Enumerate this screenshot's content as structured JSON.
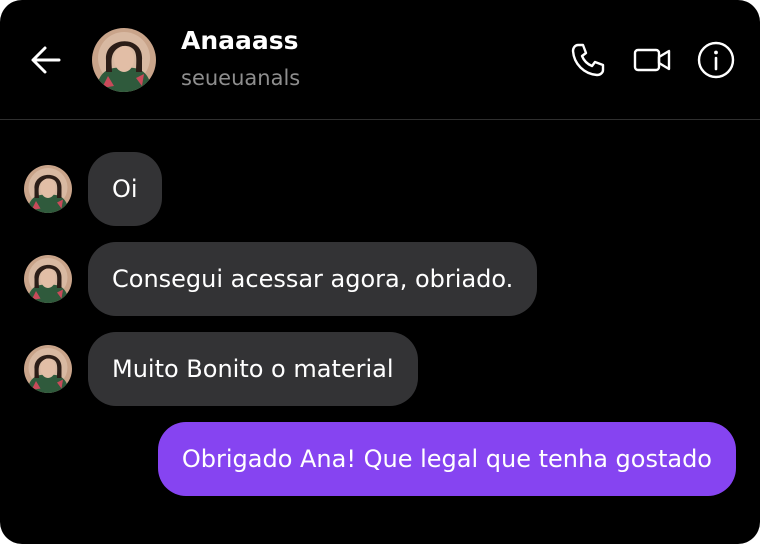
{
  "colors": {
    "background": "#000000",
    "incoming_bubble": "#333335",
    "outgoing_bubble": "#8644f1",
    "secondary_text": "#8e8e8e"
  },
  "header": {
    "back_icon": "arrow-left-icon",
    "avatar": "profile-photo",
    "name": "Anaaass",
    "username": "seueuanals",
    "actions": [
      {
        "icon": "phone-icon",
        "label": ""
      },
      {
        "icon": "video-camera-icon",
        "label": ""
      },
      {
        "icon": "info-icon",
        "label": ""
      }
    ]
  },
  "messages": [
    {
      "direction": "incoming",
      "text": "Oi"
    },
    {
      "direction": "incoming",
      "text": "Consegui acessar agora, obriado."
    },
    {
      "direction": "incoming",
      "text": "Muito Bonito o material"
    },
    {
      "direction": "outgoing",
      "text": "Obrigado Ana! Que legal que tenha gostado"
    }
  ]
}
